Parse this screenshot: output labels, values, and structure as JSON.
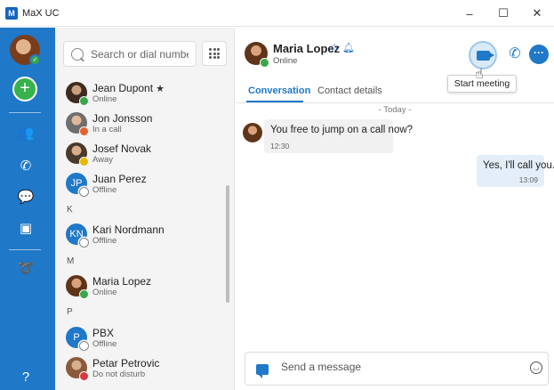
{
  "window": {
    "title": "MaX UC",
    "minimize": "–",
    "maximize": "☐",
    "close": "✕"
  },
  "rail": {
    "add_label": "+",
    "icons": [
      "contacts-icon",
      "phone-icon",
      "chat-icon",
      "meeting-icon",
      "voicemail-icon",
      "help-icon"
    ]
  },
  "search": {
    "placeholder": "Search or dial number"
  },
  "contacts": [
    {
      "name": "Jean Dupont",
      "status": "Online",
      "favorite": "★",
      "presence": "online"
    },
    {
      "name": "Jon Jonsson",
      "status": "In a call",
      "presence": "busy"
    },
    {
      "name": "Josef Novak",
      "status": "Away",
      "presence": "away"
    },
    {
      "name": "Juan Perez",
      "status": "Offline",
      "initials": "JP",
      "presence": "offline"
    },
    {
      "name": "Kari Nordmann",
      "status": "Offline",
      "initials": "KN",
      "presence": "offline"
    },
    {
      "name": "Maria Lopez",
      "status": "Online",
      "presence": "online"
    },
    {
      "name": "PBX",
      "status": "Offline",
      "initials": "P",
      "presence": "offline"
    },
    {
      "name": "Petar Petrovic",
      "status": "Do not disturb",
      "presence": "dnd"
    }
  ],
  "sections": [
    "K",
    "M",
    "P"
  ],
  "conversation": {
    "contact_name": "Maria Lopez",
    "contact_status": "Online",
    "tabs": [
      "Conversation",
      "Contact details"
    ],
    "tooltip": "Start meeting",
    "date_separator": "- Today -",
    "messages": [
      {
        "direction": "in",
        "text": "You free to jump on a call now?",
        "time": "12:30"
      },
      {
        "direction": "out",
        "text": "Yes, I'll call you.",
        "time": "13:09"
      }
    ],
    "composer_placeholder": "Send a message"
  },
  "colors": {
    "accent": "#1f78c8",
    "online": "#3aa648",
    "busy": "#e8612c",
    "away": "#e6b800",
    "dnd": "#d9363e"
  }
}
